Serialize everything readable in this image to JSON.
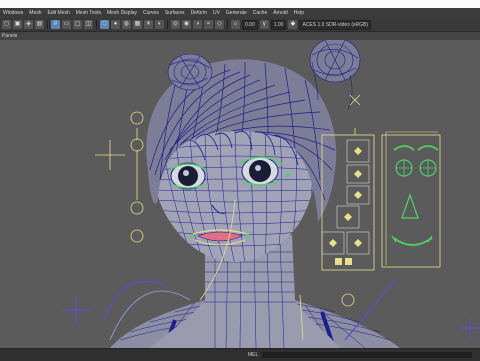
{
  "menu": {
    "items": [
      "Windows",
      "Mesh",
      "Edit Mesh",
      "Mesh Tools",
      "Mesh Display",
      "Curves",
      "Surfaces",
      "Deform",
      "UV",
      "Generate",
      "Cache",
      "Arnold",
      "Help"
    ]
  },
  "toolbar": {
    "field_a": "0.00",
    "field_b": "1.00",
    "colorspace": "ACES 1.0 SDR-video (sRGB)"
  },
  "panel": {
    "menu_label": "Panels"
  },
  "status": {
    "label": "MEL"
  },
  "colors": {
    "viewport_bg": "#5b5b5b",
    "wire": "#1c1f8a",
    "rig_yellow": "#e6e08a",
    "rig_green": "#4fd06a",
    "rig_blue": "#8ea6e8",
    "rig_purple": "#5a4fd0",
    "lips": "#e0708a"
  }
}
